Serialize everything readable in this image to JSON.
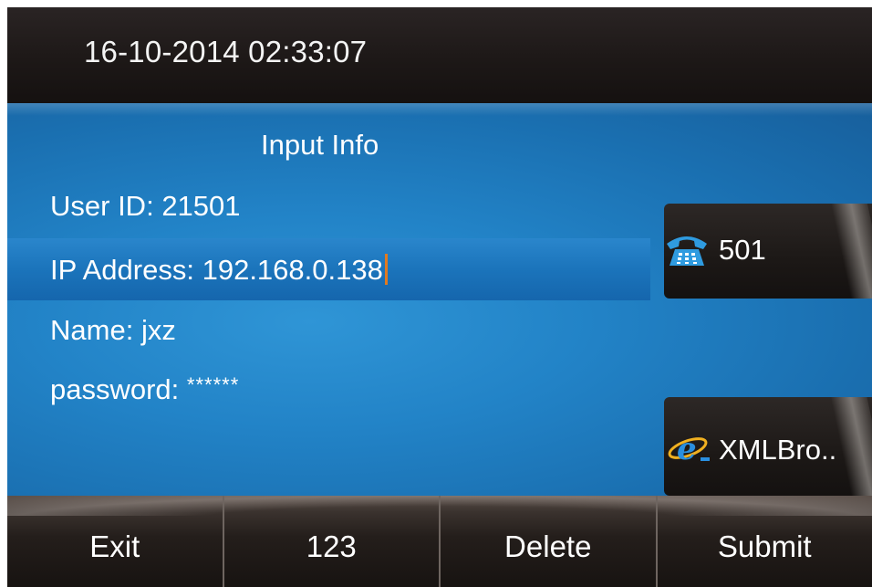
{
  "status_bar": {
    "datetime": "16-10-2014 02:33:07"
  },
  "form": {
    "title": "Input Info",
    "fields": [
      {
        "label": "User ID:",
        "value": "21501"
      },
      {
        "label": "IP Address:",
        "value": "192.168.0.138",
        "focused": true
      },
      {
        "label": "Name:",
        "value": "jxz"
      },
      {
        "label": "password:",
        "value": "******"
      }
    ]
  },
  "line_keys": [
    {
      "icon": "phone-icon",
      "label": "501"
    },
    {
      "icon": "browser-e-icon",
      "label": "XMLBro.."
    }
  ],
  "softkeys": [
    "Exit",
    "123",
    "Delete",
    "Submit"
  ],
  "colors": {
    "body_blue": "#1f6fb0",
    "focus_row": "#1b74bb",
    "caret": "#e07a20",
    "dark_bar": "#1d1817"
  }
}
